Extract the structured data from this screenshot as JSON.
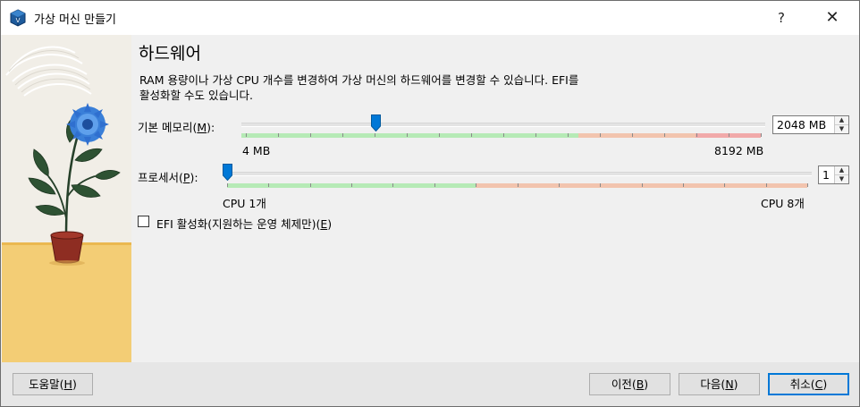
{
  "window": {
    "title": "가상 머신 만들기",
    "help_glyph": "?",
    "close_glyph": "✕"
  },
  "page": {
    "heading": "하드웨어",
    "description_line1": "RAM 용량이나 가상 CPU 개수를 변경하여 가상 머신의 하드웨어를 변경할 수 있습니다. EFI를",
    "description_line2": "활성화할 수도 있습니다."
  },
  "memory": {
    "label_prefix": "기본 메모리(",
    "label_mnemonic": "M",
    "label_suffix": "):",
    "value": "2048 MB",
    "value_mb": 2048,
    "min_label": "4 MB",
    "max_label": "8192 MB",
    "min_mb": 4,
    "max_mb": 8192
  },
  "processor": {
    "label_prefix": "프로세서(",
    "label_mnemonic": "P",
    "label_suffix": "):",
    "value": "1",
    "value_count": 1,
    "min_label": "CPU 1개",
    "max_label": "CPU 8개",
    "min": 1,
    "max": 8
  },
  "efi": {
    "label_prefix": "EFI 활성화(지원하는 운영 체제만)(",
    "label_mnemonic": "E",
    "label_suffix": ")",
    "checked": false
  },
  "buttons": {
    "help_prefix": "도움말(",
    "help_mnemonic": "H",
    "help_suffix": ")",
    "back_prefix": "이전(",
    "back_mnemonic": "B",
    "back_suffix": ")",
    "next_prefix": "다음(",
    "next_mnemonic": "N",
    "next_suffix": ")",
    "cancel_prefix": "취소(",
    "cancel_mnemonic": "C",
    "cancel_suffix": ")"
  },
  "colors": {
    "accent": "#0078d7",
    "slider_green": "#b6eab6",
    "slider_orange": "#f2c4ae",
    "slider_red": "#f1a9a9"
  },
  "icons": {
    "app": "virtualbox-icon",
    "spin_up": "spin-up-arrow-icon",
    "spin_down": "spin-down-arrow-icon"
  }
}
